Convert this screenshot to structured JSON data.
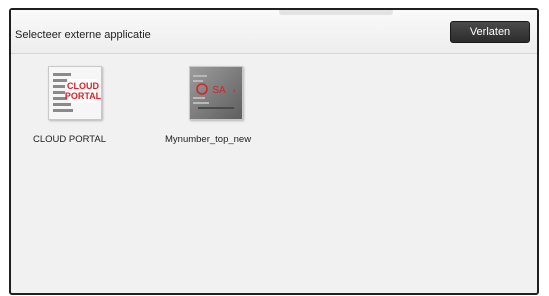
{
  "header": {
    "title": "Selecteer externe applicatie",
    "exit_label": "Verlaten"
  },
  "apps": [
    {
      "label": "CLOUD PORTAL",
      "icon": "cloud-portal-icon"
    },
    {
      "label": "Mynumber_top_new",
      "icon": "mynumber-osa-icon"
    }
  ]
}
